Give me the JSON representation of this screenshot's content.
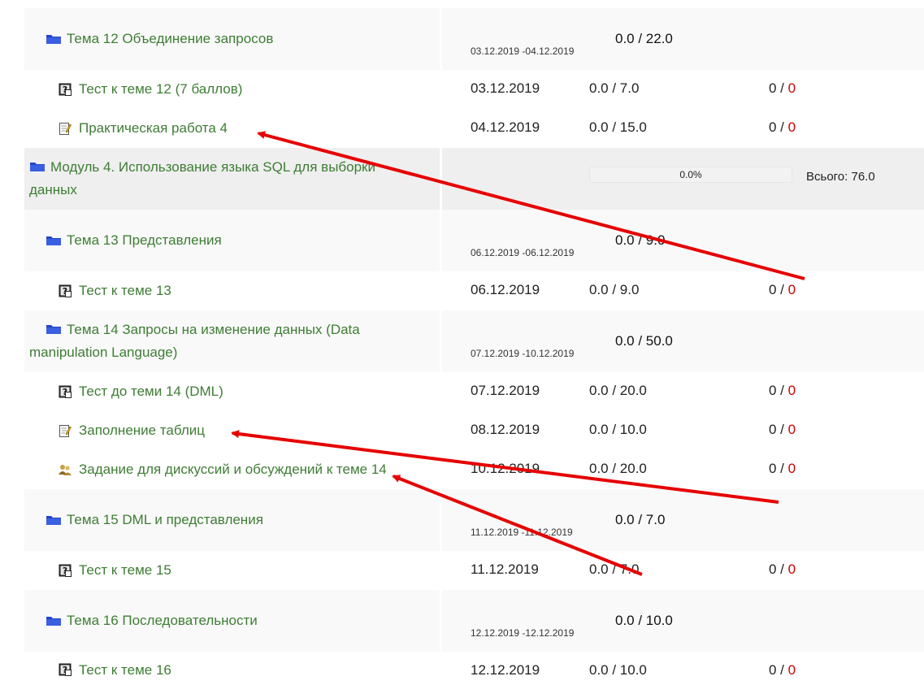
{
  "rows": [
    {
      "type": "topic",
      "name": "Тема 12 Объединение запросов",
      "dates": "03.12.2019 -04.12.2019",
      "score": "0.0 / 22.0"
    },
    {
      "type": "test",
      "name": "Тест к теме 12 (7 баллов)",
      "date": "03.12.2019",
      "score": "0.0 / 7.0",
      "attempt_done": "0 /",
      "attempt_zero": "0"
    },
    {
      "type": "assign",
      "name": "Практическая работа 4",
      "date": "04.12.2019",
      "score": "0.0 / 15.0",
      "attempt_done": "0 /",
      "attempt_zero": "0"
    },
    {
      "type": "module",
      "name": "Модуль 4. Использование языка SQL для выборки данных",
      "progress": "0.0%",
      "progress_value": 0.0,
      "total": "Всього: 76.0"
    },
    {
      "type": "topic",
      "name": "Тема 13 Представления",
      "dates": "06.12.2019 -06.12.2019",
      "score": "0.0 / 9.0"
    },
    {
      "type": "test",
      "name": "Тест к теме 13",
      "date": "06.12.2019",
      "score": "0.0 / 9.0",
      "attempt_done": "0 /",
      "attempt_zero": "0"
    },
    {
      "type": "topic",
      "name": "Тема 14 Запросы на изменение данных (Data manipulation Language)",
      "dates": "07.12.2019 -10.12.2019",
      "score": "0.0 / 50.0"
    },
    {
      "type": "test",
      "name": "Тест до теми 14 (DML)",
      "date": "07.12.2019",
      "score": "0.0 / 20.0",
      "attempt_done": "0 /",
      "attempt_zero": "0"
    },
    {
      "type": "assign",
      "name": "Заполнение таблиц",
      "date": "08.12.2019",
      "score": "0.0 / 10.0",
      "attempt_done": "0 /",
      "attempt_zero": "0"
    },
    {
      "type": "forum",
      "name": "Задание для дискуссий и обсуждений к теме 14",
      "date": "10.12.2019",
      "score": "0.0 / 20.0",
      "attempt_done": "0 /",
      "attempt_zero": "0"
    },
    {
      "type": "topic",
      "name": "Тема 15 DML и представления",
      "dates": "11.12.2019 -11.12.2019",
      "score": "0.0 / 7.0"
    },
    {
      "type": "test",
      "name": "Тест к теме 15",
      "date": "11.12.2019",
      "score": "0.0 / 7.0",
      "attempt_done": "0 /",
      "attempt_zero": "0"
    },
    {
      "type": "topic",
      "name": "Тема 16 Последовательности",
      "dates": "12.12.2019 -12.12.2019",
      "score": "0.0 / 10.0"
    },
    {
      "type": "test",
      "name": "Тест к теме 16",
      "date": "12.12.2019",
      "score": "0.0 / 10.0",
      "attempt_done": "0 /",
      "attempt_zero": "0"
    }
  ],
  "colors": {
    "link_green": "#3e7d34",
    "zero_red": "#cc0000",
    "folder_blue": "#2346c8",
    "annotation_arrow": "#e60000",
    "topic_bg": "#f9f9f9",
    "module_bg": "#efefef"
  },
  "icons": {
    "topic": "folder-icon",
    "test": "quiz-icon",
    "assign": "assignment-icon",
    "forum": "forum-icon"
  }
}
